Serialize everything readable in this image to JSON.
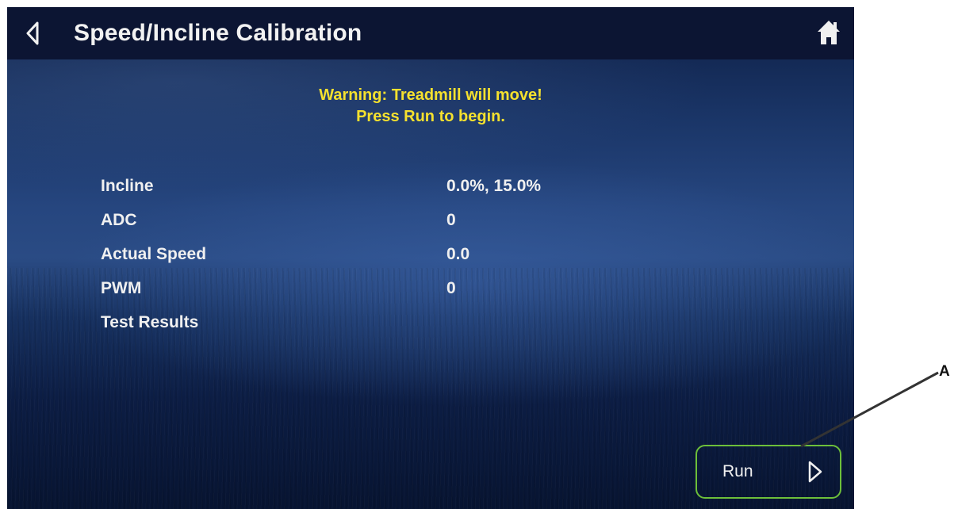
{
  "header": {
    "title": "Speed/Incline Calibration",
    "back_icon": "chevron-left-icon",
    "home_icon": "home-icon"
  },
  "warning": {
    "line1": "Warning: Treadmill will move!",
    "line2": "Press Run to begin."
  },
  "rows": [
    {
      "label": "Incline",
      "value": "0.0%, 15.0%"
    },
    {
      "label": "ADC",
      "value": "0"
    },
    {
      "label": "Actual Speed",
      "value": "0.0"
    },
    {
      "label": "PWM",
      "value": "0"
    },
    {
      "label": "Test Results",
      "value": ""
    }
  ],
  "run_button": {
    "label": "Run",
    "icon": "play-arrow-icon"
  },
  "callout": {
    "label": "A"
  },
  "colors": {
    "header_bg": "#0c1533",
    "warning_text": "#f5e12e",
    "run_border": "#6dbf3a",
    "text": "#f0f0f0"
  }
}
